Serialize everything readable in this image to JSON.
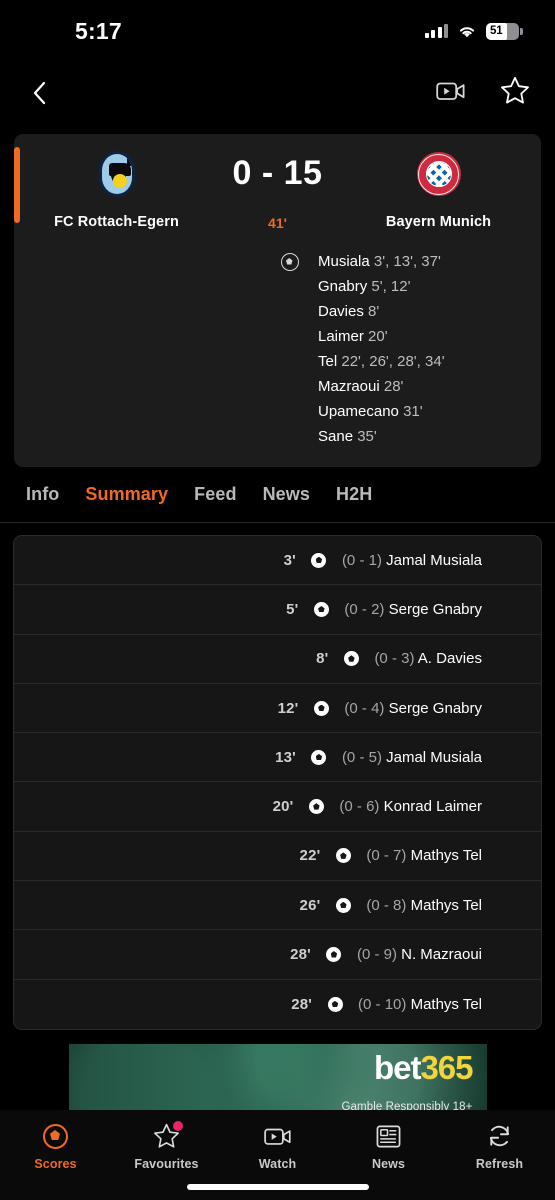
{
  "status_bar": {
    "time": "5:17",
    "battery_level": "51",
    "icons": [
      "signal-icon",
      "wifi-icon",
      "battery-icon"
    ]
  },
  "nav_bar": {
    "back_icon": "chevron-left-icon",
    "video_icon": "video-camera-icon",
    "favourite_icon": "star-icon"
  },
  "match": {
    "home_team": "FC Rottach-Egern",
    "away_team": "Bayern Munich",
    "score": "0 - 15",
    "minute": "41'",
    "live_accent": "#ef6a23",
    "scorers": [
      {
        "name": "Musiala",
        "minutes": "3', 13', 37'"
      },
      {
        "name": "Gnabry",
        "minutes": "5', 12'"
      },
      {
        "name": "Davies",
        "minutes": "8'"
      },
      {
        "name": "Laimer",
        "minutes": "20'"
      },
      {
        "name": "Tel",
        "minutes": "22', 26', 28', 34'"
      },
      {
        "name": "Mazraoui",
        "minutes": "28'"
      },
      {
        "name": "Upamecano",
        "minutes": "31'"
      },
      {
        "name": "Sane",
        "minutes": "35'"
      }
    ]
  },
  "tabs": [
    {
      "label": "Info",
      "active": false
    },
    {
      "label": "Summary",
      "active": true
    },
    {
      "label": "Feed",
      "active": false
    },
    {
      "label": "News",
      "active": false
    },
    {
      "label": "H2H",
      "active": false
    }
  ],
  "events": [
    {
      "minute": "3'",
      "score": "(0 - 1)",
      "player": "Jamal Musiala"
    },
    {
      "minute": "5'",
      "score": "(0 - 2)",
      "player": "Serge Gnabry"
    },
    {
      "minute": "8'",
      "score": "(0 - 3)",
      "player": "A. Davies"
    },
    {
      "minute": "12'",
      "score": "(0 - 4)",
      "player": "Serge Gnabry"
    },
    {
      "minute": "13'",
      "score": "(0 - 5)",
      "player": "Jamal Musiala"
    },
    {
      "minute": "20'",
      "score": "(0 - 6)",
      "player": "Konrad Laimer"
    },
    {
      "minute": "22'",
      "score": "(0 - 7)",
      "player": "Mathys Tel"
    },
    {
      "minute": "26'",
      "score": "(0 - 8)",
      "player": "Mathys Tel"
    },
    {
      "minute": "28'",
      "score": "(0 - 9)",
      "player": "N. Mazraoui"
    },
    {
      "minute": "28'",
      "score": "(0 - 10)",
      "player": "Mathys Tel"
    }
  ],
  "ad": {
    "brand_part1": "bet",
    "brand_part2": "365",
    "legal": "Gamble Responsibly 18+",
    "brand_color": "#f2d53c"
  },
  "bottom_bar": [
    {
      "label": "Scores",
      "icon": "football-icon",
      "active": true,
      "badge": false
    },
    {
      "label": "Favourites",
      "icon": "star-icon",
      "active": false,
      "badge": true
    },
    {
      "label": "Watch",
      "icon": "video-camera-icon",
      "active": false,
      "badge": false
    },
    {
      "label": "News",
      "icon": "newspaper-icon",
      "active": false,
      "badge": false
    },
    {
      "label": "Refresh",
      "icon": "refresh-icon",
      "active": false,
      "badge": false
    }
  ]
}
